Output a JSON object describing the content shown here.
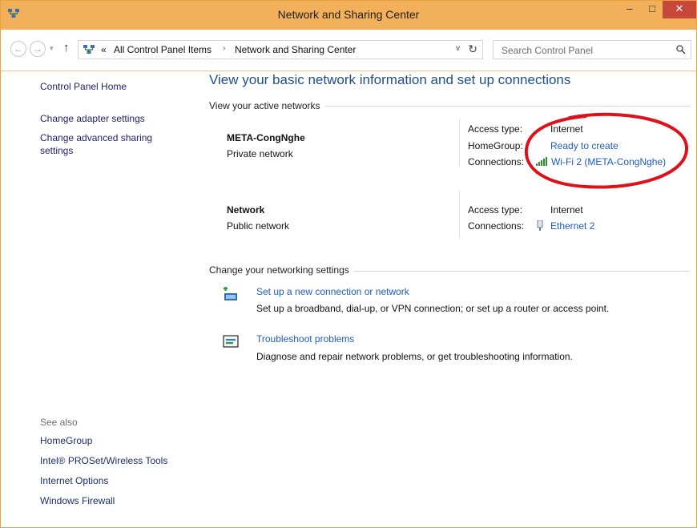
{
  "window": {
    "title": "Network and Sharing Center",
    "minimize": "–",
    "maximize": "□",
    "close": "✕"
  },
  "nav": {
    "back": "←",
    "forward": "→",
    "dropdown": "▾",
    "up": "↑",
    "breadcrumb_prefix": "«",
    "crumbs": [
      "All Control Panel Items",
      "Network and Sharing Center"
    ],
    "crumb_separator": "›",
    "address_dropdown": "v",
    "refresh": "↻",
    "search_placeholder": "Search Control Panel"
  },
  "left_pane": {
    "home": "Control Panel Home",
    "links": [
      "Change adapter settings",
      "Change advanced sharing settings"
    ],
    "see_also_label": "See also",
    "see_also": [
      "HomeGroup",
      "Intel® PROSet/Wireless Tools",
      "Internet Options",
      "Windows Firewall"
    ]
  },
  "main": {
    "heading": "View your basic network information and set up connections",
    "active_networks_label": "View your active networks",
    "networks": [
      {
        "name": "META-CongNghe",
        "type": "Private network",
        "access_type_key": "Access type:",
        "access_type_value": "Internet",
        "homegroup_key": "HomeGroup:",
        "homegroup_value": "Ready to create",
        "connections_key": "Connections:",
        "connections_value": "Wi-Fi 2 (META-CongNghe)"
      },
      {
        "name": "Network",
        "type": "Public network",
        "access_type_key": "Access type:",
        "access_type_value": "Internet",
        "connections_key": "Connections:",
        "connections_value": "Ethernet 2"
      }
    ],
    "settings_label": "Change your networking settings",
    "tasks": [
      {
        "link": "Set up a new connection or network",
        "description": "Set up a broadband, dial-up, or VPN connection; or set up a router or access point.",
        "icon": "new-connection-icon"
      },
      {
        "link": "Troubleshoot problems",
        "description": "Diagnose and repair network problems, or get troubleshooting information.",
        "icon": "troubleshoot-icon"
      }
    ]
  },
  "colors": {
    "title_bar": "#f2b05a",
    "close_button": "#c7473b",
    "link": "#1f5bc1",
    "heading": "#1e4e8c",
    "annotation": "#e0101a"
  }
}
